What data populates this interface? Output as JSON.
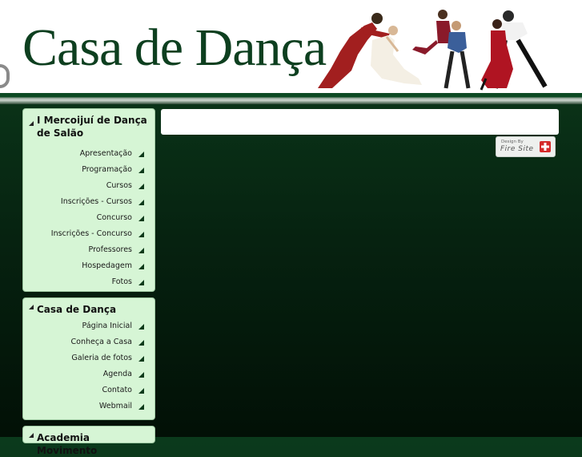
{
  "header": {
    "logo_text": "Casa de Dança"
  },
  "sidebar": {
    "boxes": [
      {
        "title": "I Mercoijuí de Dança de Salão",
        "items": [
          "Apresentação",
          "Programação",
          "Cursos",
          "Inscrições - Cursos",
          "Concurso",
          "Inscrições - Concurso",
          "Professores",
          "Hospedagem",
          "Fotos"
        ]
      },
      {
        "title": "Casa de Dança",
        "items": [
          "Página Inicial",
          "Conheça a Casa",
          "Galeria de fotos",
          "Agenda",
          "Contato",
          "Webmail"
        ]
      },
      {
        "title": "Academia Movimento"
      }
    ]
  },
  "footer_badge": {
    "small_text": "Design By",
    "brand_text": "Fire Site",
    "icon": "firesite-cross-icon"
  },
  "colors": {
    "background": "#062210",
    "header_text": "#0d3f1f",
    "menu_box": "#d6f5d5",
    "arrow": "#0d3a1a"
  }
}
